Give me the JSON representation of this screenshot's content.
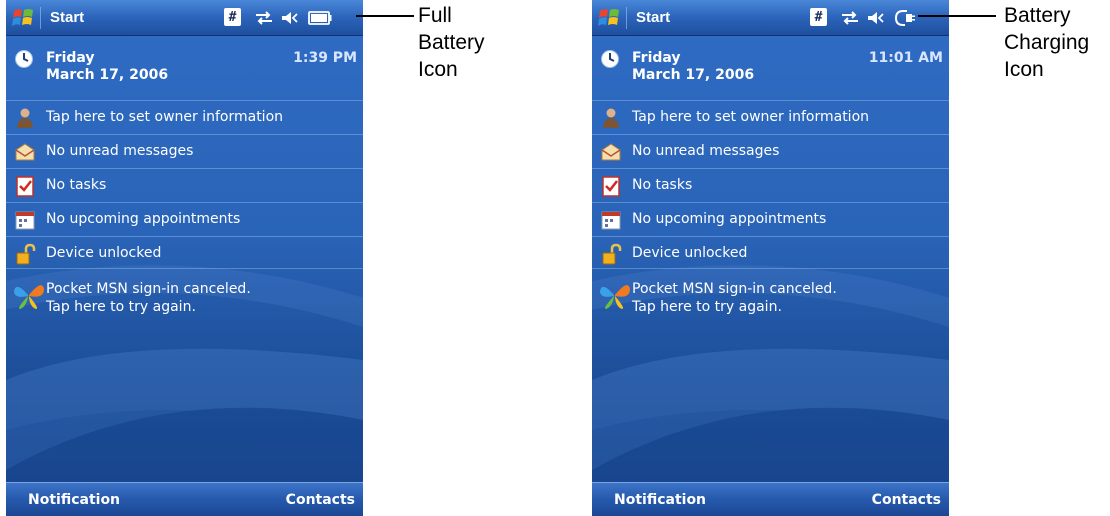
{
  "screens": [
    {
      "title": "Start",
      "day": "Friday",
      "date": "March 17, 2006",
      "time": "1:39 PM",
      "items": [
        "Tap here to set owner information",
        "No unread messages",
        "No tasks",
        "No upcoming appointments",
        "Device unlocked"
      ],
      "msn_line1": "Pocket MSN sign-in canceled.",
      "msn_line2": "Tap here to try again.",
      "softkey_left": "Notification",
      "softkey_right": "Contacts",
      "battery_icon": "full-battery-icon"
    },
    {
      "title": "Start",
      "day": "Friday",
      "date": "March 17, 2006",
      "time": "11:01 AM",
      "items": [
        "Tap here to set owner information",
        "No unread messages",
        "No tasks",
        "No upcoming appointments",
        "Device unlocked"
      ],
      "msn_line1": "Pocket MSN sign-in canceled.",
      "msn_line2": "Tap here to try again.",
      "softkey_left": "Notification",
      "softkey_right": "Contacts",
      "battery_icon": "battery-charging-icon"
    }
  ],
  "callouts": [
    {
      "line1": "Full",
      "line2": "Battery",
      "line3": "Icon"
    },
    {
      "line1": "Battery",
      "line2": "Charging",
      "line3": "Icon"
    }
  ],
  "colors": {
    "screen_top": "#2f6cc4",
    "screen_bottom": "#163f86",
    "text": "#ffffff",
    "time_text": "#d9e6ff"
  }
}
